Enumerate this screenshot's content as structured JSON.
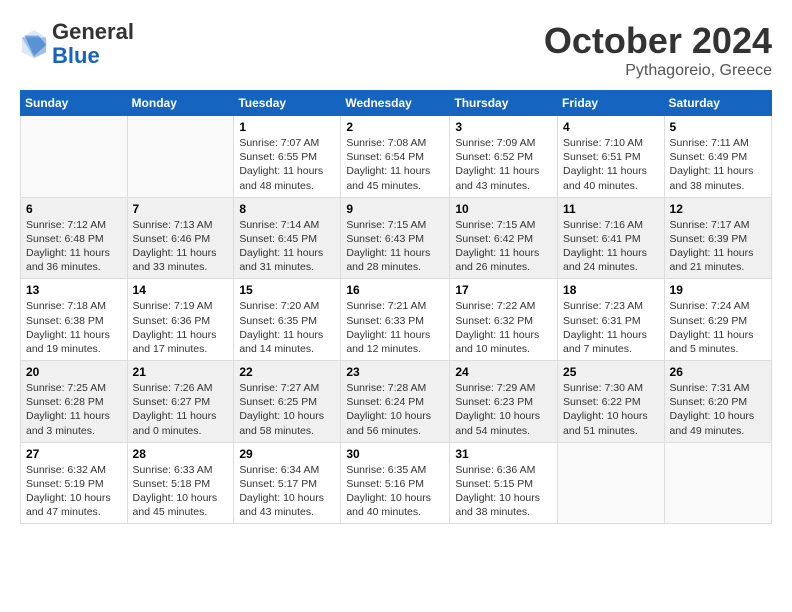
{
  "header": {
    "logo_line1": "General",
    "logo_line2": "Blue",
    "month": "October 2024",
    "location": "Pythagoreio, Greece"
  },
  "days_of_week": [
    "Sunday",
    "Monday",
    "Tuesday",
    "Wednesday",
    "Thursday",
    "Friday",
    "Saturday"
  ],
  "weeks": [
    [
      {
        "day": "",
        "info": ""
      },
      {
        "day": "",
        "info": ""
      },
      {
        "day": "1",
        "info": "Sunrise: 7:07 AM\nSunset: 6:55 PM\nDaylight: 11 hours and 48 minutes."
      },
      {
        "day": "2",
        "info": "Sunrise: 7:08 AM\nSunset: 6:54 PM\nDaylight: 11 hours and 45 minutes."
      },
      {
        "day": "3",
        "info": "Sunrise: 7:09 AM\nSunset: 6:52 PM\nDaylight: 11 hours and 43 minutes."
      },
      {
        "day": "4",
        "info": "Sunrise: 7:10 AM\nSunset: 6:51 PM\nDaylight: 11 hours and 40 minutes."
      },
      {
        "day": "5",
        "info": "Sunrise: 7:11 AM\nSunset: 6:49 PM\nDaylight: 11 hours and 38 minutes."
      }
    ],
    [
      {
        "day": "6",
        "info": "Sunrise: 7:12 AM\nSunset: 6:48 PM\nDaylight: 11 hours and 36 minutes."
      },
      {
        "day": "7",
        "info": "Sunrise: 7:13 AM\nSunset: 6:46 PM\nDaylight: 11 hours and 33 minutes."
      },
      {
        "day": "8",
        "info": "Sunrise: 7:14 AM\nSunset: 6:45 PM\nDaylight: 11 hours and 31 minutes."
      },
      {
        "day": "9",
        "info": "Sunrise: 7:15 AM\nSunset: 6:43 PM\nDaylight: 11 hours and 28 minutes."
      },
      {
        "day": "10",
        "info": "Sunrise: 7:15 AM\nSunset: 6:42 PM\nDaylight: 11 hours and 26 minutes."
      },
      {
        "day": "11",
        "info": "Sunrise: 7:16 AM\nSunset: 6:41 PM\nDaylight: 11 hours and 24 minutes."
      },
      {
        "day": "12",
        "info": "Sunrise: 7:17 AM\nSunset: 6:39 PM\nDaylight: 11 hours and 21 minutes."
      }
    ],
    [
      {
        "day": "13",
        "info": "Sunrise: 7:18 AM\nSunset: 6:38 PM\nDaylight: 11 hours and 19 minutes."
      },
      {
        "day": "14",
        "info": "Sunrise: 7:19 AM\nSunset: 6:36 PM\nDaylight: 11 hours and 17 minutes."
      },
      {
        "day": "15",
        "info": "Sunrise: 7:20 AM\nSunset: 6:35 PM\nDaylight: 11 hours and 14 minutes."
      },
      {
        "day": "16",
        "info": "Sunrise: 7:21 AM\nSunset: 6:33 PM\nDaylight: 11 hours and 12 minutes."
      },
      {
        "day": "17",
        "info": "Sunrise: 7:22 AM\nSunset: 6:32 PM\nDaylight: 11 hours and 10 minutes."
      },
      {
        "day": "18",
        "info": "Sunrise: 7:23 AM\nSunset: 6:31 PM\nDaylight: 11 hours and 7 minutes."
      },
      {
        "day": "19",
        "info": "Sunrise: 7:24 AM\nSunset: 6:29 PM\nDaylight: 11 hours and 5 minutes."
      }
    ],
    [
      {
        "day": "20",
        "info": "Sunrise: 7:25 AM\nSunset: 6:28 PM\nDaylight: 11 hours and 3 minutes."
      },
      {
        "day": "21",
        "info": "Sunrise: 7:26 AM\nSunset: 6:27 PM\nDaylight: 11 hours and 0 minutes."
      },
      {
        "day": "22",
        "info": "Sunrise: 7:27 AM\nSunset: 6:25 PM\nDaylight: 10 hours and 58 minutes."
      },
      {
        "day": "23",
        "info": "Sunrise: 7:28 AM\nSunset: 6:24 PM\nDaylight: 10 hours and 56 minutes."
      },
      {
        "day": "24",
        "info": "Sunrise: 7:29 AM\nSunset: 6:23 PM\nDaylight: 10 hours and 54 minutes."
      },
      {
        "day": "25",
        "info": "Sunrise: 7:30 AM\nSunset: 6:22 PM\nDaylight: 10 hours and 51 minutes."
      },
      {
        "day": "26",
        "info": "Sunrise: 7:31 AM\nSunset: 6:20 PM\nDaylight: 10 hours and 49 minutes."
      }
    ],
    [
      {
        "day": "27",
        "info": "Sunrise: 6:32 AM\nSunset: 5:19 PM\nDaylight: 10 hours and 47 minutes."
      },
      {
        "day": "28",
        "info": "Sunrise: 6:33 AM\nSunset: 5:18 PM\nDaylight: 10 hours and 45 minutes."
      },
      {
        "day": "29",
        "info": "Sunrise: 6:34 AM\nSunset: 5:17 PM\nDaylight: 10 hours and 43 minutes."
      },
      {
        "day": "30",
        "info": "Sunrise: 6:35 AM\nSunset: 5:16 PM\nDaylight: 10 hours and 40 minutes."
      },
      {
        "day": "31",
        "info": "Sunrise: 6:36 AM\nSunset: 5:15 PM\nDaylight: 10 hours and 38 minutes."
      },
      {
        "day": "",
        "info": ""
      },
      {
        "day": "",
        "info": ""
      }
    ]
  ]
}
